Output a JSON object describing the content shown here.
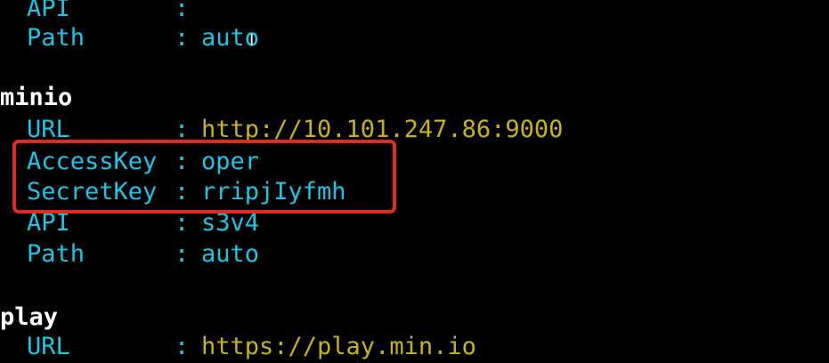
{
  "terminal": {
    "background": "#000000",
    "key_color": "#19c6e5",
    "url_color": "#c6b414",
    "section_color": "#ffffff",
    "highlight_color": "#e22b1f"
  },
  "first_section": {
    "rows": [
      {
        "key": "API",
        "sep": ":",
        "value": ""
      },
      {
        "key": "Path",
        "sep": ":",
        "value": "auto"
      }
    ]
  },
  "minio": {
    "name": "minio",
    "rows": [
      {
        "key": "URL",
        "sep": ":",
        "value": "http://10.101.247.86:9000"
      },
      {
        "key": "AccessKey",
        "sep": ":",
        "value": "oper"
      },
      {
        "key": "SecretKey",
        "sep": ":",
        "value": "rripjIyfmh"
      },
      {
        "key": "API",
        "sep": ":",
        "value": "s3v4"
      },
      {
        "key": "Path",
        "sep": ":",
        "value": "auto"
      }
    ]
  },
  "play": {
    "name": "play",
    "rows": [
      {
        "key": "URL",
        "sep": ":",
        "value": "https://play.min.io"
      }
    ]
  },
  "icons": {
    "text_cursor": "text-cursor-icon"
  }
}
